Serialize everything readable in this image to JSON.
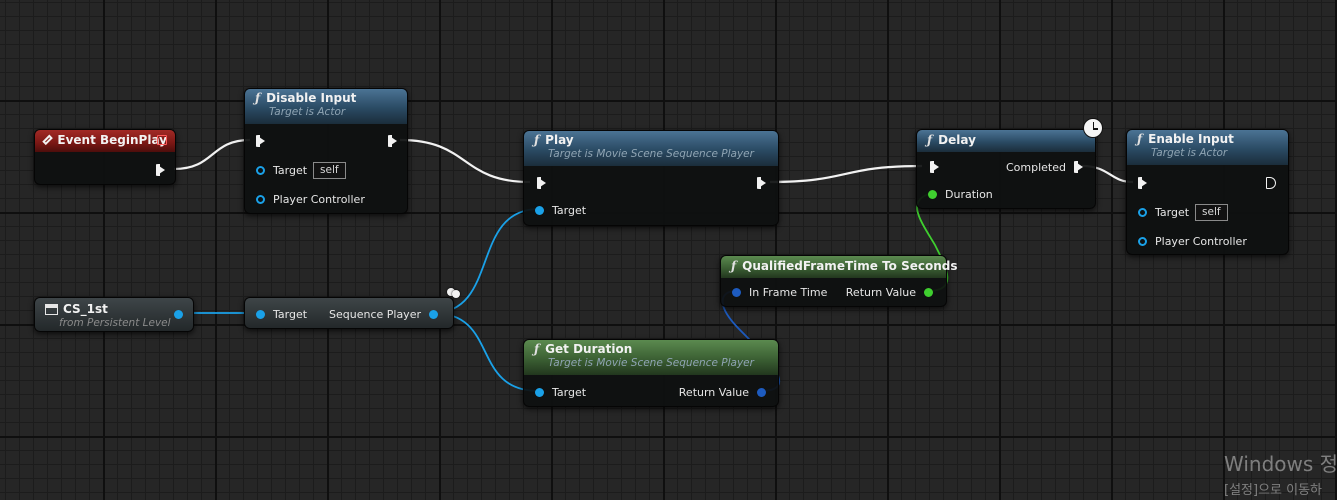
{
  "colors": {
    "exec_wire": "#f2f2f2",
    "object_wire": "#1aa1e8",
    "float_wire": "#3fcf2f",
    "struct_wire": "#1d5bbf",
    "event_header": "#a22a26",
    "function_header": "#2a4a63",
    "pure_header": "#3b5f33"
  },
  "nodes": {
    "event_begin_play": {
      "title": "Event BeginPlay",
      "icon": "event-diamond-icon"
    },
    "disable_input": {
      "title": "Disable Input",
      "subtitle": "Target is Actor",
      "icon": "function-f-icon",
      "target_label": "Target",
      "target_value": "self",
      "player_controller_label": "Player Controller"
    },
    "play": {
      "title": "Play",
      "subtitle": "Target is Movie Scene Sequence Player",
      "icon": "function-f-icon",
      "target_label": "Target"
    },
    "delay": {
      "title": "Delay",
      "icon": "function-f-icon",
      "completed_label": "Completed",
      "duration_label": "Duration",
      "latent_icon": "clock-icon"
    },
    "enable_input": {
      "title": "Enable Input",
      "subtitle": "Target is Actor",
      "icon": "function-f-icon",
      "target_label": "Target",
      "target_value": "self",
      "player_controller_label": "Player Controller"
    },
    "qualified_frame_time": {
      "title": "QualifiedFrameTime To Seconds",
      "icon": "function-f-icon",
      "in_label": "In Frame Time",
      "return_label": "Return Value"
    },
    "cs_1st": {
      "title": "CS_1st",
      "subtitle": "from Persistent Level",
      "icon": "clapperboard-icon"
    },
    "sequence_player": {
      "target_label": "Target",
      "output_label": "Sequence Player"
    },
    "get_duration": {
      "title": "Get Duration",
      "subtitle": "Target is Movie Scene Sequence Player",
      "icon": "function-f-icon",
      "target_label": "Target",
      "return_label": "Return Value"
    }
  },
  "watermark": {
    "line1": "Windows 정",
    "line2": "[설정]으로 이동하"
  }
}
